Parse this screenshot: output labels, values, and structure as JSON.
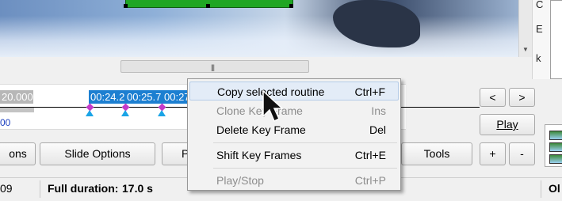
{
  "right_panel": {
    "labels": [
      "C",
      "E",
      "k"
    ]
  },
  "timeline": {
    "start_time": "20.000",
    "key_times": [
      "00:24.2",
      "00:25.7",
      "00:27"
    ],
    "bottom_label": "00"
  },
  "buttons": {
    "prev": "<",
    "next": ">",
    "play": "Play",
    "plus": "+",
    "minus": "-",
    "project_options_partial": "ons",
    "slide_options": "Slide Options",
    "partial_p": "P",
    "tools": "Tools"
  },
  "context_menu": {
    "items": [
      {
        "label": "Copy selected routine",
        "shortcut": "Ctrl+F",
        "enabled": true,
        "highlighted": true
      },
      {
        "label": "Clone Key Frame",
        "shortcut": "Ins",
        "enabled": false
      },
      {
        "label": "Delete Key Frame",
        "shortcut": "Del",
        "enabled": true
      },
      {
        "label": "Shift Key Frames",
        "shortcut": "Ctrl+E",
        "enabled": true
      },
      {
        "label": "Play/Stop",
        "shortcut": "Ctrl+P",
        "enabled": false
      }
    ]
  },
  "status_bar": {
    "left_partial": "09",
    "full_duration_label": "Full duration:",
    "full_duration_value": "17.0 s",
    "right_partial": "Ol"
  },
  "colors": {
    "accent_blue": "#1c7fd1",
    "green_selection": "#1fa624",
    "marker_magenta": "#c33ac9",
    "marker_cyan": "#1aa4e6"
  }
}
